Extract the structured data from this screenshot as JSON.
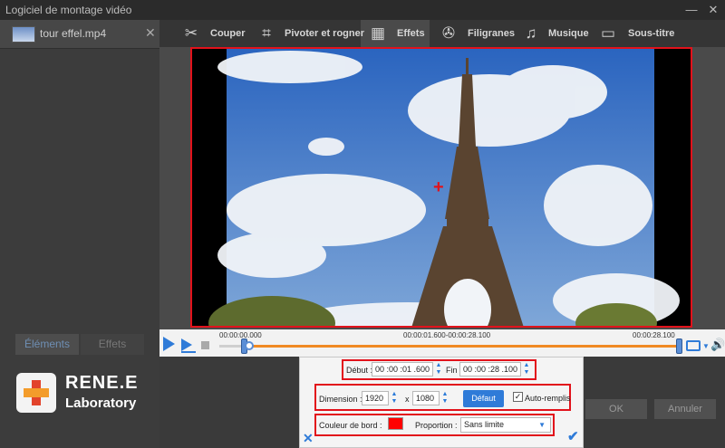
{
  "window": {
    "title": "Logiciel de montage vidéo",
    "minimize": "—",
    "close": "✕"
  },
  "file": {
    "name": "tour effel.mp4",
    "close": "✕"
  },
  "left_tabs": {
    "elements": "Éléments",
    "effects": "Effets"
  },
  "toolbar": {
    "items": [
      {
        "label": "Couper",
        "icon": "scissors-icon",
        "glyph": "✂"
      },
      {
        "label": "Pivoter et rogner",
        "icon": "crop-icon",
        "glyph": "⌗"
      },
      {
        "label": "Effets",
        "icon": "effects-icon",
        "glyph": "▦"
      },
      {
        "label": "Filigranes",
        "icon": "film-reel-icon",
        "glyph": "✇"
      },
      {
        "label": "Musique",
        "icon": "music-note-icon",
        "glyph": "♫"
      },
      {
        "label": "Sous-titre",
        "icon": "subtitle-icon",
        "glyph": "▭"
      }
    ],
    "active": "Effets"
  },
  "timeline": {
    "start": "00:00:00.000",
    "range": "00:00:01.600-00:00:28.100",
    "end": "00:00:28.100",
    "start_fraction": 0.0,
    "end_fraction": 1.0
  },
  "dialog": {
    "start_label": "Début :",
    "start_value": "00 :00 :01 .600",
    "end_label": "Fin :",
    "end_value": "00 :00 :28 .100",
    "dimension_label": "Dimension :",
    "width": "1920",
    "x": "x",
    "height": "1080",
    "default_button": "Défaut",
    "autofill_label": "Auto-remplis",
    "autofill_checked": true,
    "border_color_label": "Couleur de bord :",
    "border_color": "#ff0000",
    "proportion_label": "Proportion :",
    "proportion_value": "Sans limite"
  },
  "bottom_buttons": {
    "ok": "OK",
    "cancel": "Annuler"
  },
  "logo": {
    "line1": "RENE.E",
    "line2": "Laboratory"
  },
  "colors": {
    "accent": "#2f7bd8",
    "highlight": "#e2121b",
    "track": "#f08a24"
  }
}
